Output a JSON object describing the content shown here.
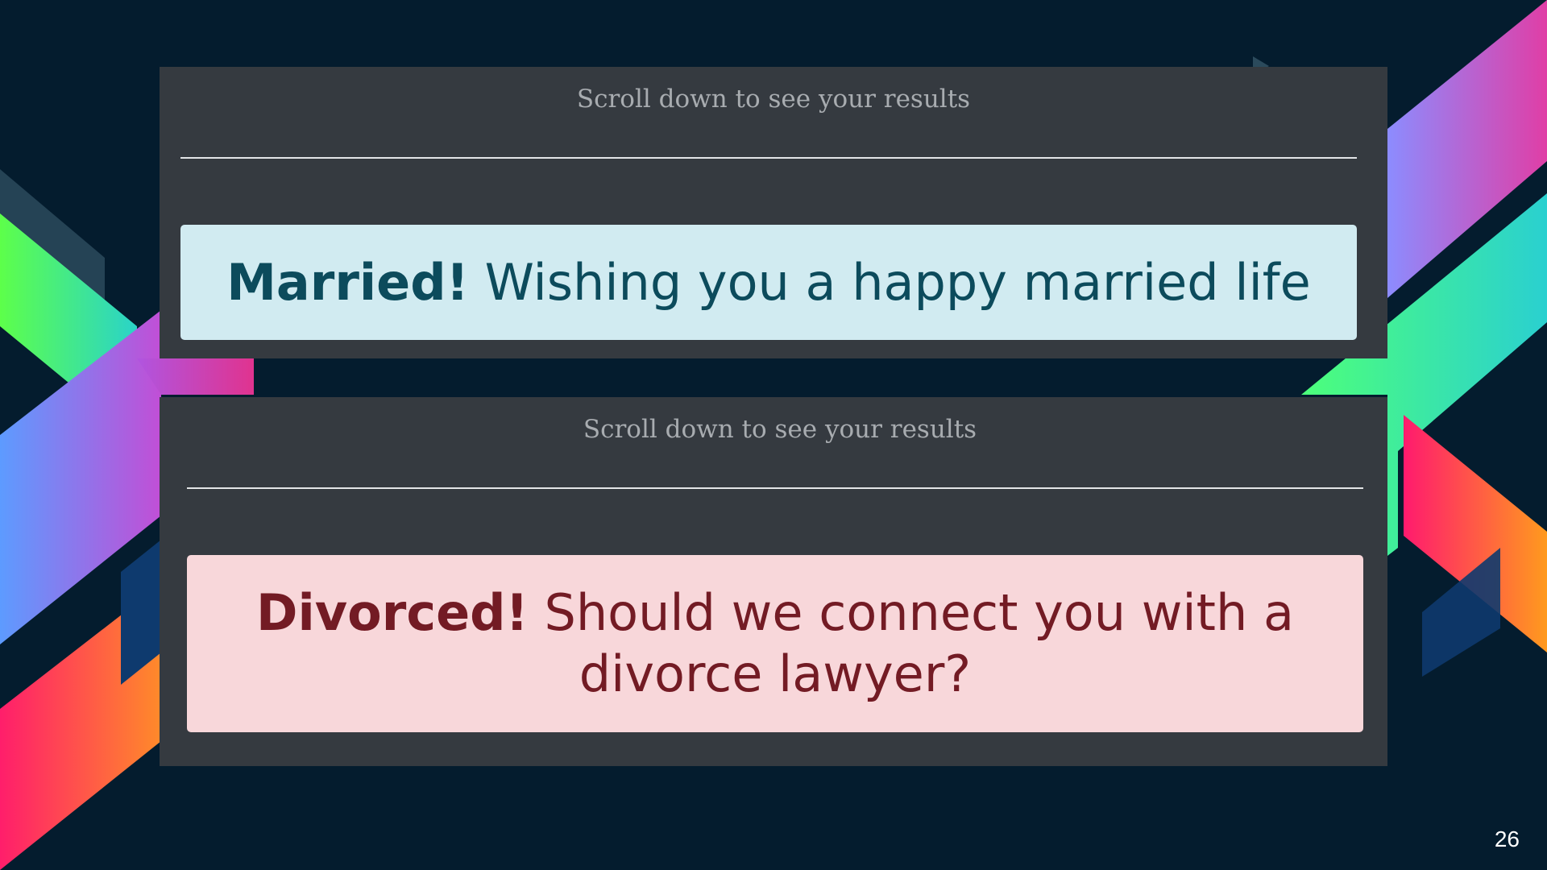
{
  "slide": {
    "number": "26",
    "background_color": "#041c2e"
  },
  "results_top": {
    "hint": "Scroll down to see your results",
    "alert_strong": "Married!",
    "alert_text": " Wishing you a happy married life",
    "alert_bg": "#d1ebf1",
    "alert_color": "#0c4b5c"
  },
  "results_bottom": {
    "hint": "Scroll down to see your results",
    "alert_strong": "Divorced!",
    "alert_text": " Should we connect you with a divorce lawyer?",
    "alert_bg": "#f8d7da",
    "alert_color": "#731b24"
  }
}
